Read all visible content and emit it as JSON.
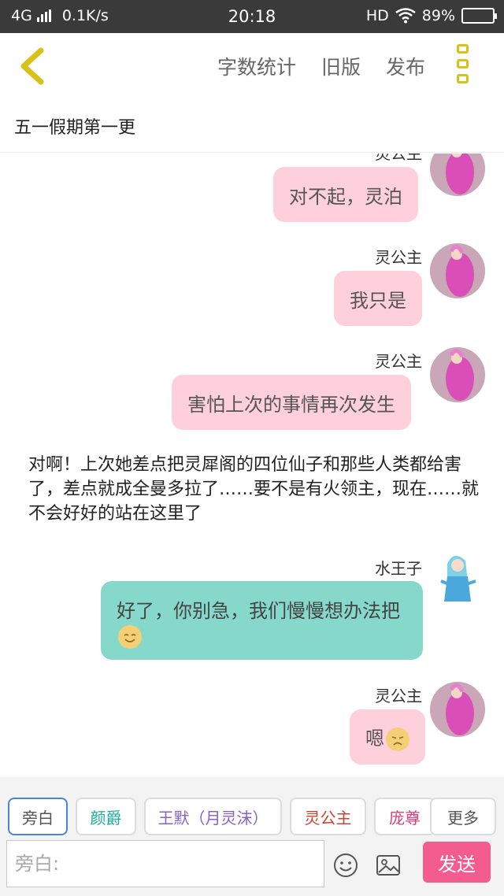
{
  "status_bar": {
    "network": "4G",
    "speed": "0.1K/s",
    "time": "20:18",
    "hd": "HD",
    "battery_text": "89%",
    "battery_level": 0.89
  },
  "toolbar": {
    "word_count": "字数统计",
    "old_version": "旧版",
    "publish": "发布"
  },
  "chapter_title": "五一假期第一更",
  "messages": [
    {
      "sender": "灵公主",
      "text": "对不起，灵泊"
    },
    {
      "sender": "灵公主",
      "text": "我只是"
    },
    {
      "sender": "灵公主",
      "text": "害怕上次的事情再次发生"
    },
    {
      "sender": "旁白",
      "text": "对啊！上次她差点把灵犀阁的四位仙子和那些人类都给害了，差点就成全曼多拉了……要不是有火领主，现在……就不会好好的站在这里了"
    },
    {
      "sender": "水王子",
      "text": "好了，你别急，我们慢慢想办法把",
      "emoji": "smile-emoji"
    },
    {
      "sender": "灵公主",
      "text": "嗯",
      "emoji": "sad-emoji"
    }
  ],
  "speakers": [
    {
      "label": "旁白",
      "color": "#555555",
      "selected": true
    },
    {
      "label": "颜爵",
      "color": "#1aa89a"
    },
    {
      "label": "王默（月灵沫）",
      "color": "#8c5fc4"
    },
    {
      "label": "灵公主",
      "color": "#c9452f"
    },
    {
      "label": "庞尊",
      "color": "#d43f7c"
    },
    {
      "label": "更多",
      "color": "#555555"
    }
  ],
  "input": {
    "placeholder": "旁白:"
  },
  "send_label": "发送",
  "colors": {
    "accent": "#d8c21a",
    "send_button": "#f45b8e",
    "pink_bubble": "#fdd0dc",
    "teal_bubble": "#86d8ca"
  }
}
